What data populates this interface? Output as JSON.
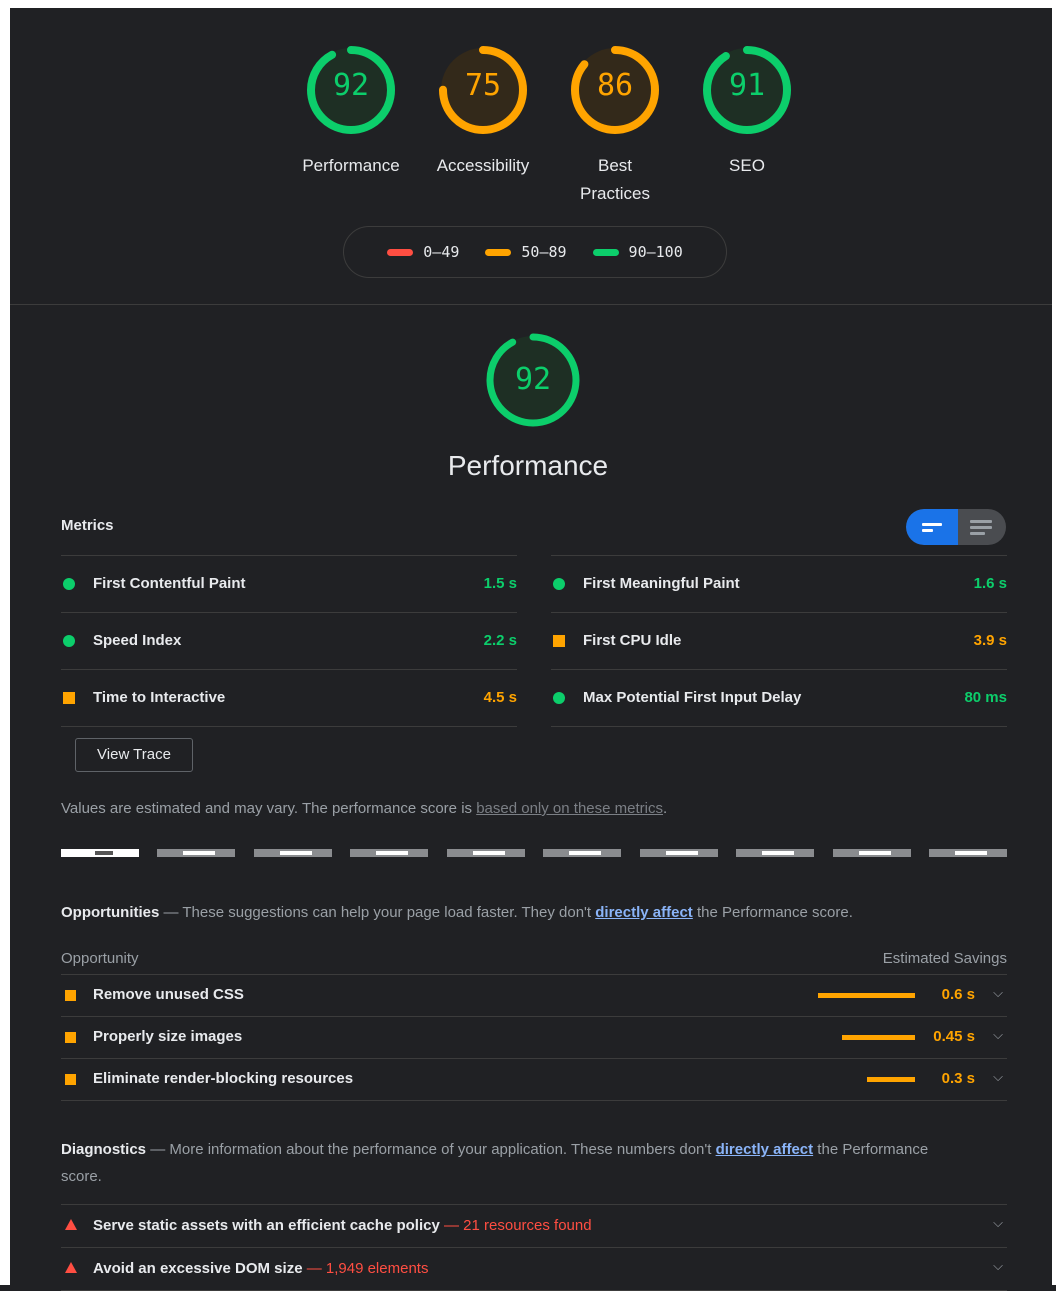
{
  "colors": {
    "pass": "#0cce6b",
    "average": "#ffa400",
    "fail": "#ff4e42"
  },
  "scores": [
    {
      "value": "92",
      "label": "Performance",
      "status": "pass"
    },
    {
      "value": "75",
      "label": "Accessibility",
      "status": "average"
    },
    {
      "value": "86",
      "label": "Best Practices",
      "status": "average"
    },
    {
      "value": "91",
      "label": "SEO",
      "status": "pass"
    }
  ],
  "legend": {
    "fail": "0–49",
    "average": "50–89",
    "pass": "90–100"
  },
  "performance": {
    "score": "92",
    "title": "Performance"
  },
  "metrics": {
    "title": "Metrics",
    "left": [
      {
        "label": "First Contentful Paint",
        "value": "1.5 s",
        "status": "pass"
      },
      {
        "label": "Speed Index",
        "value": "2.2 s",
        "status": "pass"
      },
      {
        "label": "Time to Interactive",
        "value": "4.5 s",
        "status": "average"
      }
    ],
    "right": [
      {
        "label": "First Meaningful Paint",
        "value": "1.6 s",
        "status": "pass"
      },
      {
        "label": "First CPU Idle",
        "value": "3.9 s",
        "status": "average"
      },
      {
        "label": "Max Potential First Input Delay",
        "value": "80 ms",
        "status": "pass"
      }
    ],
    "view_trace": "View Trace",
    "note_prefix": "Values are estimated and may vary. The performance score is ",
    "note_link": "based only on these metrics",
    "note_suffix": "."
  },
  "opportunities": {
    "title": "Opportunities",
    "desc_prefix": " — These suggestions can help your page load faster. They don't ",
    "desc_link": "directly affect",
    "desc_suffix": " the Performance score.",
    "col_left": "Opportunity",
    "col_right": "Estimated Savings",
    "rows": [
      {
        "label": "Remove unused CSS",
        "savings": "0.6 s",
        "savings_seconds": 0.6
      },
      {
        "label": "Properly size images",
        "savings": "0.45 s",
        "savings_seconds": 0.45
      },
      {
        "label": "Eliminate render-blocking resources",
        "savings": "0.3 s",
        "savings_seconds": 0.3
      }
    ]
  },
  "diagnostics": {
    "title": "Diagnostics",
    "desc_prefix": " — More information about the performance of your application. These numbers don't ",
    "desc_link": "directly affect",
    "desc_suffix": " the Performance score.",
    "rows": [
      {
        "label": "Serve static assets with an efficient cache policy",
        "extra": " — 21 resources found"
      },
      {
        "label": "Avoid an excessive DOM size",
        "extra": " — 1,949 elements"
      }
    ]
  }
}
